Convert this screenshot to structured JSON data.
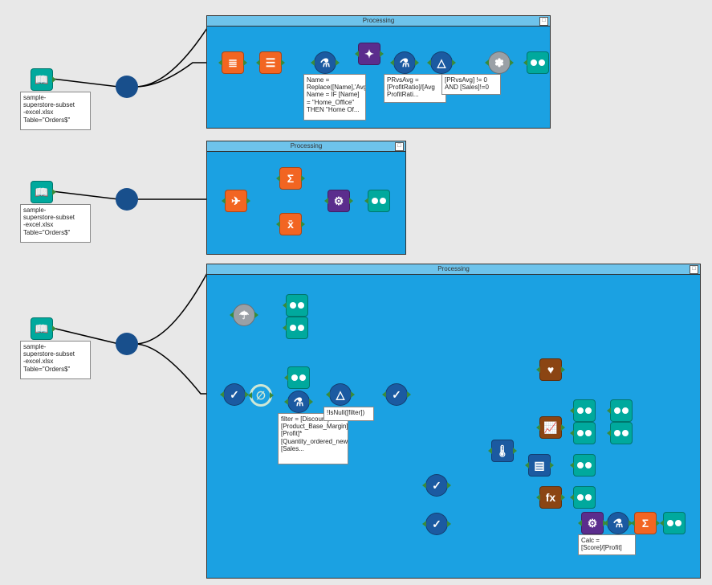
{
  "containers": {
    "c1_title": "Processing",
    "c2_title": "Processing",
    "c3_title": "Processing"
  },
  "inputs": {
    "input1": "sample-\nsuperstore-subset\n-excel.xlsx\nTable=\"Orders$\"",
    "input2": "sample-\nsuperstore-subset\n-excel.xlsx\nTable=\"Orders$\"",
    "input3": "sample-\nsuperstore-subset\n-excel.xlsx\nTable=\"Orders$\""
  },
  "annotations": {
    "a1": "Name = Replace([Name],'Avg_',\"\")\nName = IF [Name] = \"Home_Office\" THEN \"Home Of...",
    "a2": "PRvsAvg = [ProfitRatio]/[Avg ProfitRati...",
    "a3": "[PRvsAvg] != 0 AND [Sales]!=0",
    "a4": "filter = [Discount]*[Product_Base_Margin]*[Profit]*[Quantity_ordered_new]*[Sales...",
    "a5": "!IsNull([filter])",
    "a6": "Calc = [Score]/[Profit]"
  },
  "icons": {
    "book": "📖",
    "select": "☰",
    "formula": "fn",
    "join": "⊕",
    "filter": "△",
    "browse": "bn",
    "sum": "Σ",
    "xbar": "x̄",
    "run": "⤵",
    "gear": "⚙",
    "umbrella": "☂",
    "check": "✓",
    "null": "∅",
    "thermo": "🌡",
    "chart": "📈",
    "heart": "❤",
    "book2": "📘"
  }
}
